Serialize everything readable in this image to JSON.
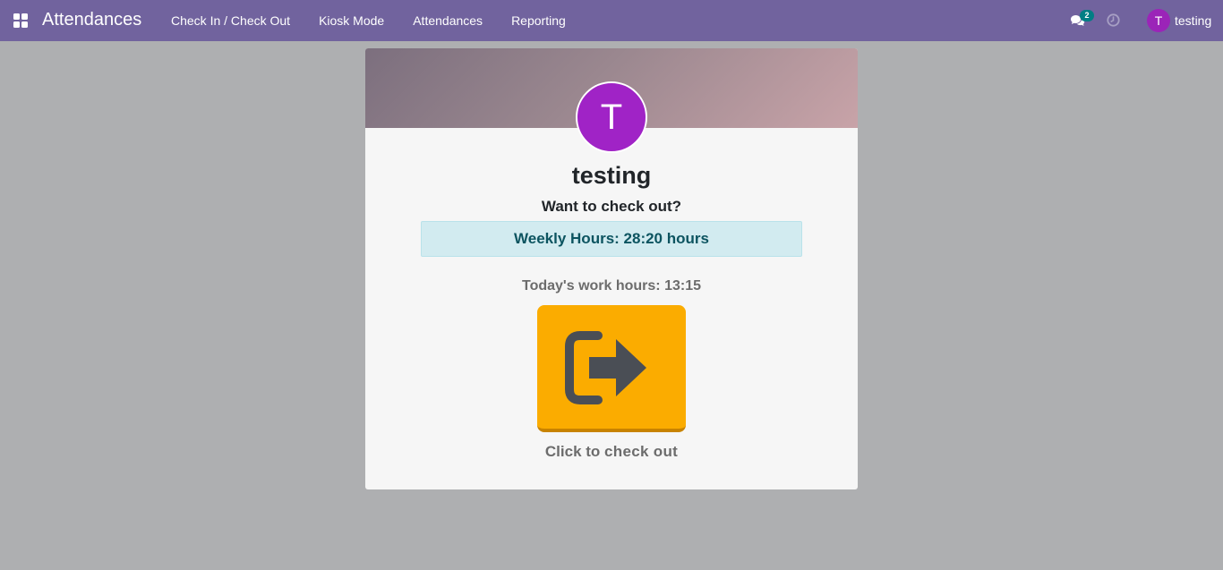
{
  "navbar": {
    "app_title": "Attendances",
    "menu": [
      {
        "label": "Check In / Check Out"
      },
      {
        "label": "Kiosk Mode"
      },
      {
        "label": "Attendances"
      },
      {
        "label": "Reporting"
      }
    ],
    "messages_count": "2",
    "user_initial": "T",
    "user_name": "testing"
  },
  "card": {
    "avatar_initial": "T",
    "employee_name": "testing",
    "question": "Want to check out?",
    "weekly_hours": "Weekly Hours: 28:20 hours",
    "today_hours": "Today's work hours: 13:15",
    "click_prefix": "Click to",
    "click_action": "check out"
  },
  "colors": {
    "navbar": "#71639e",
    "background": "#aeafb1",
    "button": "#fbac00",
    "avatar": "#a023c6",
    "badge": "#017e84"
  },
  "icons": {
    "apps": "apps-grid-icon",
    "chat": "chat-icon",
    "clock": "clock-icon",
    "checkout": "sign-out-icon"
  }
}
